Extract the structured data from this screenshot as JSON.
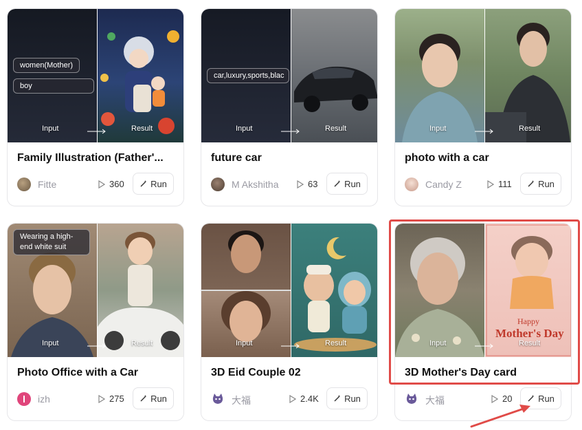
{
  "labels": {
    "input": "Input",
    "result": "Result",
    "run": "Run"
  },
  "cards": [
    {
      "title": "Family Illustration (Father'...",
      "author": "Fitte",
      "runs": "360",
      "chips": [
        "women(Mother)",
        "boy"
      ],
      "colors": {
        "left": "#1e2230",
        "right": "#2a3a66",
        "avatar": "#8b7355"
      }
    },
    {
      "title": "future car",
      "author": "M Akshitha",
      "runs": "63",
      "chips": [
        "car,luxury,sports,blac"
      ],
      "colors": {
        "left": "#1f2230",
        "right": "#6a6e78",
        "avatar": "#6b5646"
      }
    },
    {
      "title": "photo with a car",
      "author": "Candy Z",
      "runs": "111",
      "chips": [],
      "colors": {
        "left": "#7a9a6a",
        "right": "#5d7a55",
        "avatar": "#e8d2c8"
      }
    },
    {
      "title": "Photo Office with a Car",
      "author": "izh",
      "runs": "275",
      "chips": [
        "Wearing a high-end white suit"
      ],
      "colors": {
        "left": "#8a7260",
        "right": "#c9c7c2",
        "avatar": "#e0457b"
      }
    },
    {
      "title": "3D Eid Couple 02",
      "author": "大福",
      "runs": "2.4K",
      "chips": [],
      "colors": {
        "left": "#7a5a48",
        "right": "#3f7f7c",
        "avatar": "#6a5a9a"
      }
    },
    {
      "title": "3D Mother's Day card",
      "author": "大福",
      "runs": "20",
      "chips": [],
      "overlay_text": [
        "Happy",
        "Mother's Day"
      ],
      "colors": {
        "left": "#8a8270",
        "right": "#f0c6c0",
        "avatar": "#6a5a9a"
      }
    }
  ],
  "highlight_color": "#e04b48"
}
